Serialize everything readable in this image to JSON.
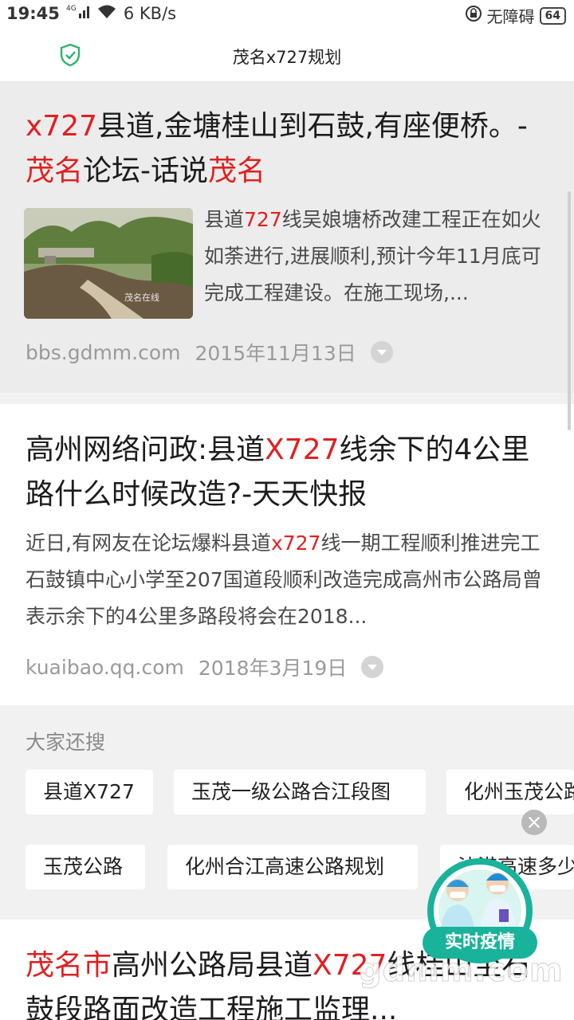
{
  "status_bar": {
    "time": "19:45",
    "network": "4G",
    "speed": "6 KB/s",
    "accessibility": "无障碍",
    "battery": "64"
  },
  "header": {
    "title": "茂名x727规划"
  },
  "results": [
    {
      "title_parts": [
        {
          "text": "x727",
          "hl": true
        },
        {
          "text": "县道,金塘桂山到石鼓,有座便桥。-",
          "hl": false
        },
        {
          "text": "茂名",
          "hl": true
        },
        {
          "text": "论坛-话说",
          "hl": false
        },
        {
          "text": "茂名",
          "hl": true
        }
      ],
      "snippet_parts": [
        {
          "text": "县道",
          "hl": false
        },
        {
          "text": "727",
          "hl": true
        },
        {
          "text": "线吴娘塘桥改建工程正在如火如荼进行,进展顺利,预计今年11月底可完成工程建设。在施工现场,...",
          "hl": false
        }
      ],
      "source": "bbs.gdmm.com",
      "date": "2015年11月13日",
      "thumb_watermark": "茂名在线"
    },
    {
      "title_parts": [
        {
          "text": "高州网络问政:县道",
          "hl": false
        },
        {
          "text": "X727",
          "hl": true
        },
        {
          "text": "线余下的4公里路什么时候改造?-天天快报",
          "hl": false
        }
      ],
      "snippet_parts": [
        {
          "text": "近日,有网友在论坛爆料县道",
          "hl": false
        },
        {
          "text": "x727",
          "hl": true
        },
        {
          "text": "线一期工程顺利推进完工石鼓镇中心小学至207国道段顺利改造完成高州市公路局曾表示余下的4公里多路段将会在2018...",
          "hl": false
        }
      ],
      "source": "kuaibao.qq.com",
      "date": "2018年3月19日"
    },
    {
      "title_parts": [
        {
          "text": "茂名市",
          "hl": true
        },
        {
          "text": "高州公路局县道",
          "hl": false
        },
        {
          "text": "X727",
          "hl": true
        },
        {
          "text": "线桂山至石鼓段路面改造工程施工监理...",
          "hl": false
        }
      ]
    }
  ],
  "related": {
    "title": "大家还搜",
    "chips": [
      "县道X727",
      "玉茂一级公路合江段图",
      "化州玉茂公路",
      "玉茂公路",
      "化州合江高速公路规划",
      "沙港高速多少"
    ]
  },
  "floating_badge": {
    "label": "实时疫情"
  },
  "watermark": "gdmm.com",
  "colors": {
    "highlight": "#e02020",
    "shield": "#2db46b",
    "badge": "#18b39a"
  }
}
